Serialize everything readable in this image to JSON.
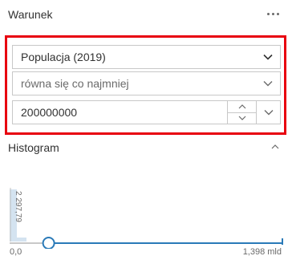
{
  "header": {
    "title": "Warunek",
    "more_icon": "more-horizontal-icon"
  },
  "condition": {
    "field": {
      "value": "Populacja (2019)",
      "icon": "chevron-down-icon"
    },
    "operator": {
      "value": "równa się co najmniej",
      "icon": "chevron-down-icon"
    },
    "value_input": {
      "value": "200000000",
      "increment_icon": "chevron-up-icon",
      "decrement_icon": "chevron-down-icon",
      "dropdown_icon": "chevron-down-icon"
    }
  },
  "histogram": {
    "title": "Histogram",
    "toggle_icon": "chevron-up-icon",
    "axis_tick_label": "2 297,79",
    "min_label": "0,0",
    "max_label": "1,398 mld",
    "slider_position_fraction": 0.143,
    "colors": {
      "accent": "#2a7ab8",
      "bars": "#d4e3f0",
      "highlight_border": "#e8000f"
    }
  }
}
